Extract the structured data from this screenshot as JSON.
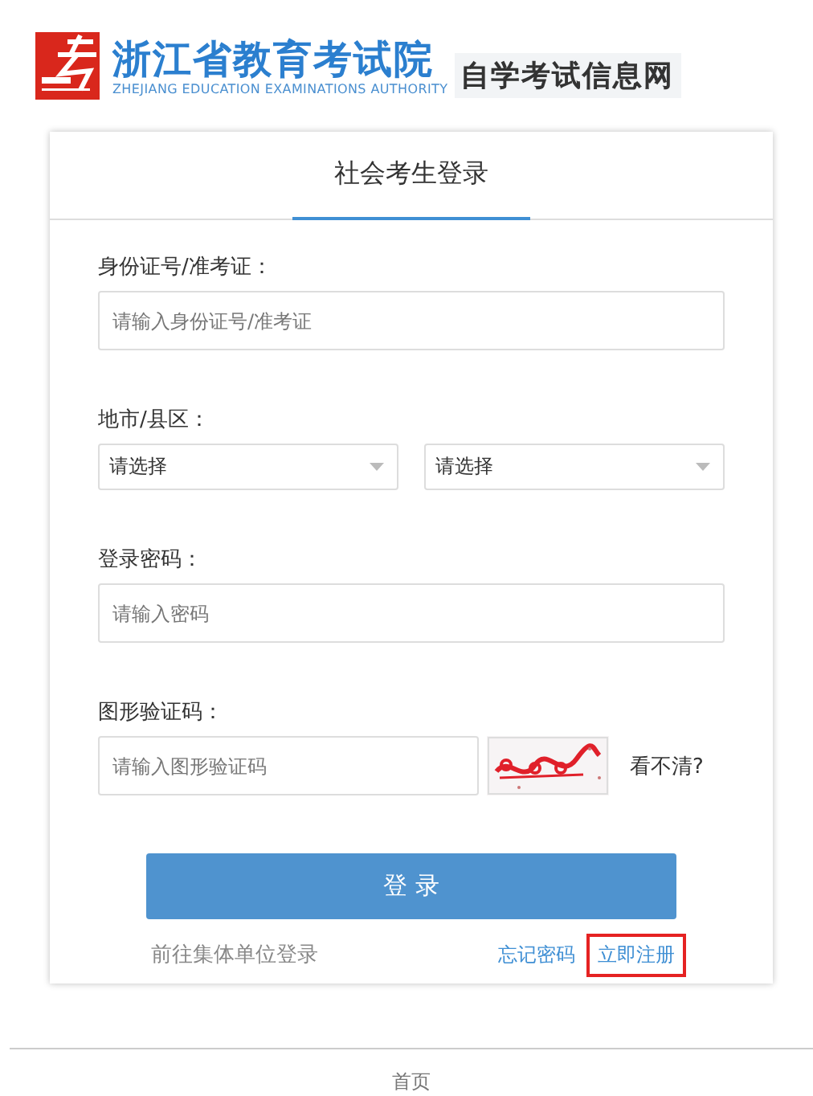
{
  "header": {
    "title": "浙江省教育考试院",
    "subtitle": "ZHEJIANG EDUCATION EXAMINATIONS AUTHORITY",
    "site": "自学考试信息网"
  },
  "login": {
    "tabs": [
      {
        "label": "社会考生登录",
        "selected": true
      }
    ],
    "fields": [
      {
        "kind": "text",
        "label": "身份证号/准考证：",
        "placeholder": "请输入身份证号/准考证"
      },
      {
        "kind": "selects",
        "label": "地市/县区：",
        "options": [
          "请选择",
          "请选择"
        ]
      },
      {
        "kind": "text",
        "label": "登录密码：",
        "placeholder": "请输入密码"
      },
      {
        "kind": "captcha",
        "label": "图形验证码：",
        "placeholder": "请输入图形验证码",
        "refresh": "看不清?"
      }
    ],
    "submit": "登 录",
    "links": [
      {
        "kind": "muted",
        "text": "前往集体单位登录",
        "highlighted": false
      },
      {
        "kind": "link",
        "text": "忘记密码",
        "highlighted": false
      },
      {
        "kind": "link",
        "text": "立即注册",
        "highlighted": true
      }
    ]
  },
  "footer": {
    "links": [
      "首页"
    ]
  }
}
